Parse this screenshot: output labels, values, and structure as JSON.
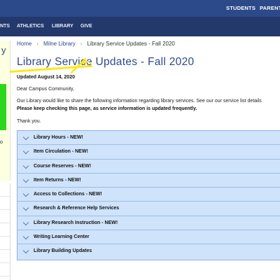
{
  "topbar": {
    "links": [
      "STUDENTS",
      "PARENTS"
    ]
  },
  "navbar": {
    "links": [
      "NTS",
      "ATHLETICS",
      "LIBRARY",
      "GIVE"
    ]
  },
  "sidebar": {
    "title_fragment": "y",
    "item_fragment": "o"
  },
  "breadcrumb": {
    "home": "Home",
    "library": "Milne Library",
    "current": "Library Service Updates - Fall 2020"
  },
  "page": {
    "title": "Library Service Updates - Fall 2020",
    "updated": "Updated August 14,  2020",
    "greeting": "Dear Campus Community,",
    "intro": "Our Library would like to share the following information regarding library services.  See our our service list details",
    "keep_checking": "Please keep checking this page, as service information is updated frequently.",
    "thanks": "Thank you."
  },
  "accordion": {
    "items": [
      "Library Hours - NEW!",
      "Item Circulation - NEW!",
      "Course Reserves - NEW!",
      "Item Returns - NEW!",
      "Access to Collections - NEW!",
      "Research & Reference Help Services",
      "Library Research Instruction - NEW!",
      "Writing Learning Center",
      "Library Building Updates"
    ]
  },
  "colors": {
    "header_top": "#2c4a8a",
    "header_nav": "#23386b",
    "title": "#2c4a8a",
    "accordion_bg": "#cfe3fb",
    "highlighter": "#ffe814",
    "sidebar_green": "#2bd61d"
  }
}
